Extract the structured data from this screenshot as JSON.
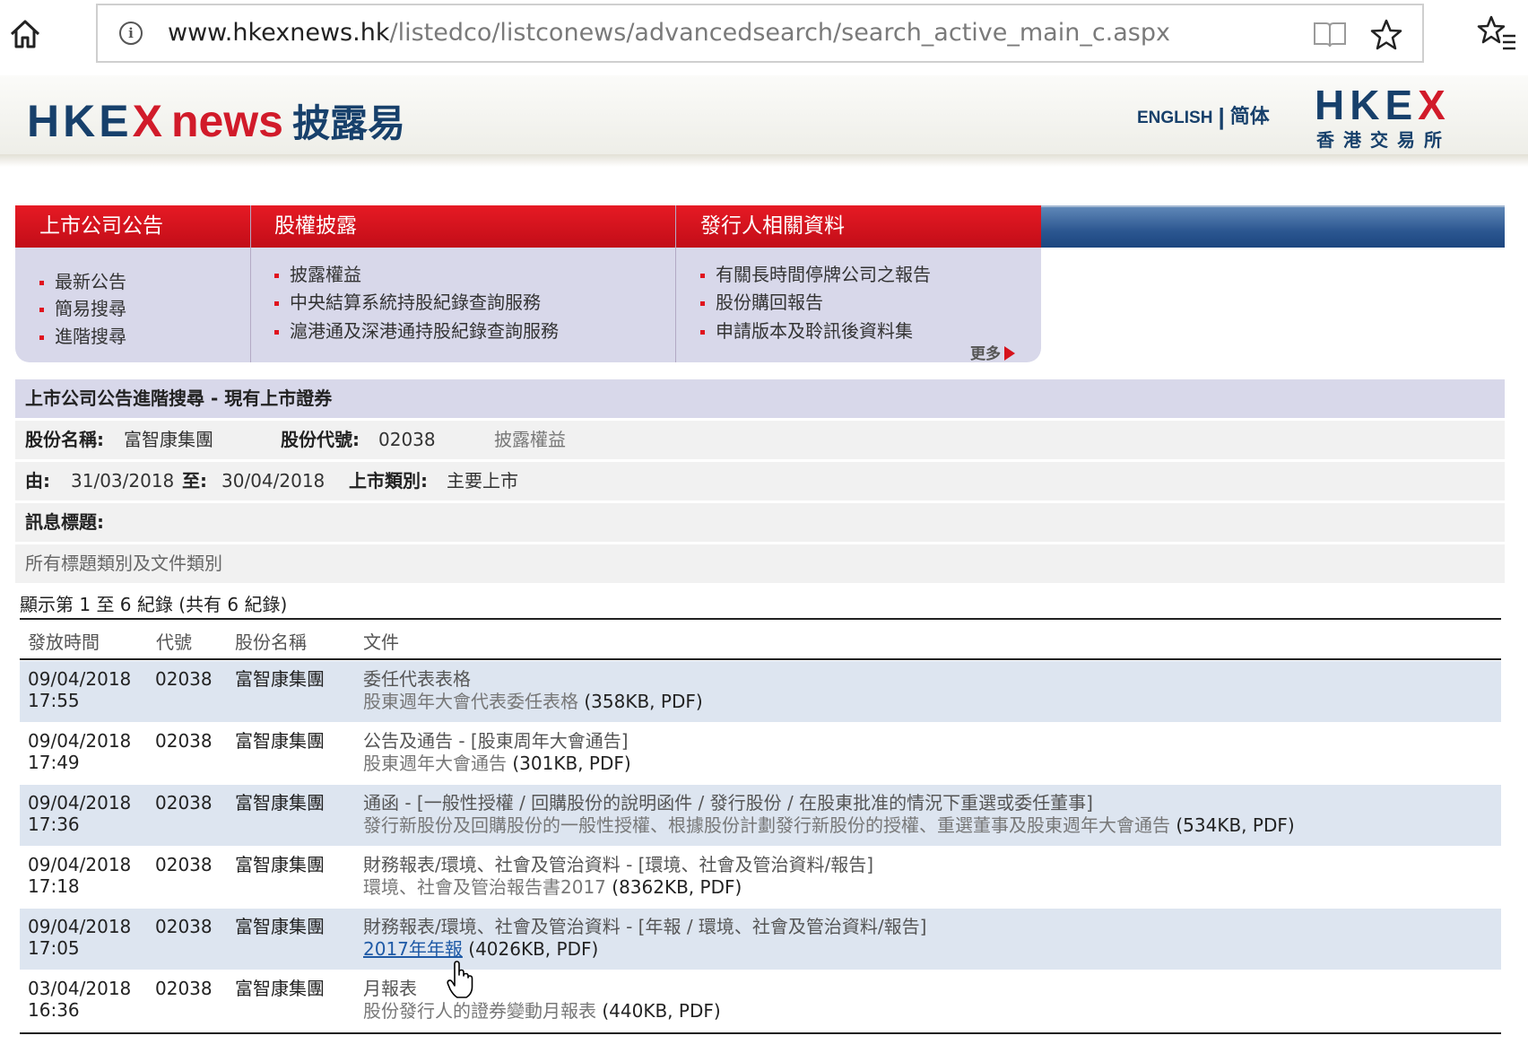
{
  "browser": {
    "url_host": "www.hkexnews.hk",
    "url_path": "/listedco/listconews/advancedsearch/search_active_main_c.aspx",
    "icons": [
      "home-icon",
      "info-icon",
      "reading-view-icon",
      "favorite-star-icon",
      "favorites-list-icon"
    ]
  },
  "header": {
    "logo_hke": "HKE",
    "logo_x": "X",
    "logo_news": "news",
    "logo_cn": "披露易",
    "lang_english": "ENGLISH",
    "lang_simplified": "简体",
    "hkex_logo_text": "HKEX",
    "hkex_logo_hke": "HKE",
    "hkex_logo_x": "X",
    "hkex_logo_cn": "香港交易所"
  },
  "nav": {
    "sections": [
      {
        "title": "上市公司公告",
        "items": [
          "最新公告",
          "簡易搜尋",
          "進階搜尋"
        ]
      },
      {
        "title": "股權披露",
        "items": [
          "披露權益",
          "中央結算系統持股紀錄查詢服務",
          "滬港通及深港通持股紀錄查詢服務"
        ]
      },
      {
        "title": "發行人相關資料",
        "items": [
          "有關長時間停牌公司之報告",
          "股份購回報告",
          "申請版本及聆訊後資料集"
        ]
      }
    ],
    "more": "更多"
  },
  "criteria": {
    "title": "上市公司公告進階搜尋 - 現有上市證券",
    "stock_name_label": "股份名稱:",
    "stock_name": "富智康集團",
    "stock_code_label": "股份代號:",
    "stock_code": "02038",
    "disclosure_link": "披露權益",
    "from_label": "由:",
    "from_date": "31/03/2018",
    "to_label": "至:",
    "to_date": "30/04/2018",
    "market_label": "上市類別:",
    "market": "主要上市",
    "headline_label": "訊息標題:",
    "headline_value": "所有標題類別及文件類別"
  },
  "results": {
    "count_text": "顯示第 1 至 6 紀錄 (共有 6 紀錄)",
    "columns": [
      "發放時間",
      "代號",
      "股份名稱",
      "文件"
    ],
    "rows": [
      {
        "date": "09/04/2018",
        "time": "17:55",
        "code": "02038",
        "name": "富智康集團",
        "title": "委任代表表格",
        "doc": "股東週年大會代表委任表格",
        "size": "(358KB, PDF)"
      },
      {
        "date": "09/04/2018",
        "time": "17:49",
        "code": "02038",
        "name": "富智康集團",
        "title": "公告及通告 - [股東周年大會通告]",
        "doc": "股東週年大會通告",
        "size": "(301KB, PDF)"
      },
      {
        "date": "09/04/2018",
        "time": "17:36",
        "code": "02038",
        "name": "富智康集團",
        "title": "通函 - [一般性授權 / 回購股份的說明函件 / 發行股份 / 在股東批准的情況下重選或委任董事]",
        "doc": "發行新股份及回購股份的一般性授權、根據股份計劃發行新股份的授權、重選董事及股東週年大會通告",
        "size": "(534KB, PDF)"
      },
      {
        "date": "09/04/2018",
        "time": "17:18",
        "code": "02038",
        "name": "富智康集團",
        "title": "財務報表/環境、社會及管治資料 - [環境、社會及管治資料/報告]",
        "doc": "環境、社會及管治報告書2017",
        "size": "(8362KB, PDF)"
      },
      {
        "date": "09/04/2018",
        "time": "17:05",
        "code": "02038",
        "name": "富智康集團",
        "title": "財務報表/環境、社會及管治資料 - [年報 / 環境、社會及管治資料/報告]",
        "doc": "2017年年報",
        "size": "(4026KB, PDF)"
      },
      {
        "date": "03/04/2018",
        "time": "16:36",
        "code": "02038",
        "name": "富智康集團",
        "title": "月報表",
        "doc": "股份發行人的證券變動月報表",
        "size": "(440KB, PDF)"
      }
    ]
  },
  "colors": {
    "brand_navy": "#17406b",
    "brand_red": "#d11b2a",
    "nav_panel": "#d8d8ea",
    "row_alt": "#dde5f0",
    "link": "#1f5aa6"
  }
}
